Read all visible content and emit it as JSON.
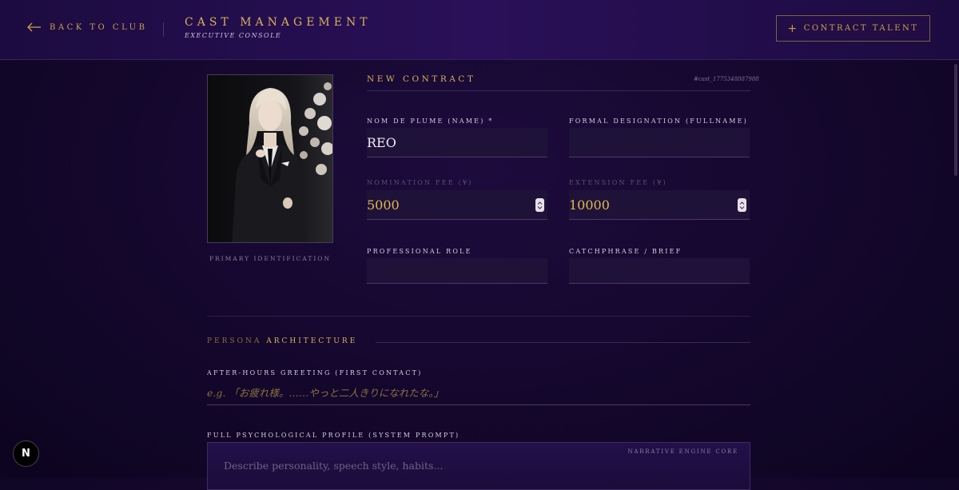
{
  "header": {
    "back_label": "BACK TO CLUB",
    "title": "CAST MANAGEMENT",
    "subtitle": "EXECUTIVE CONSOLE",
    "contract_button": "CONTRACT TALENT"
  },
  "photo": {
    "caption": "PRIMARY IDENTIFICATION"
  },
  "contract": {
    "heading": "NEW CONTRACT",
    "cast_id": "#cast_1775348887988",
    "name_label": "NOM DE PLUME (NAME) *",
    "name_value": "REO",
    "fullname_label": "FORMAL DESIGNATION (FULLNAME)",
    "fullname_value": "",
    "nomination_label": "NOMINATION FEE (¥)",
    "nomination_value": "5000",
    "extension_label": "EXTENSION FEE (¥)",
    "extension_value": "10000",
    "role_label": "PROFESSIONAL ROLE",
    "role_value": "",
    "catchphrase_label": "CATCHPHRASE / BRIEF",
    "catchphrase_value": ""
  },
  "persona": {
    "heading_a": "PERSONA",
    "heading_b": "ARCHITECTURE",
    "greeting_label": "AFTER-HOURS GREETING (FIRST CONTACT)",
    "greeting_placeholder": "e.g. 「お疲れ様。……やっと二人きりになれたな。」",
    "profile_label": "FULL PSYCHOLOGICAL PROFILE (SYSTEM PROMPT)",
    "engine_core": "NARRATIVE ENGINE CORE",
    "profile_placeholder": "Describe personality, speech style, habits..."
  },
  "badge": {
    "letter": "N"
  },
  "colors": {
    "accent_gold": "#d6b25a",
    "bg_deep": "#14072c",
    "header_bg": "#2a1058"
  }
}
